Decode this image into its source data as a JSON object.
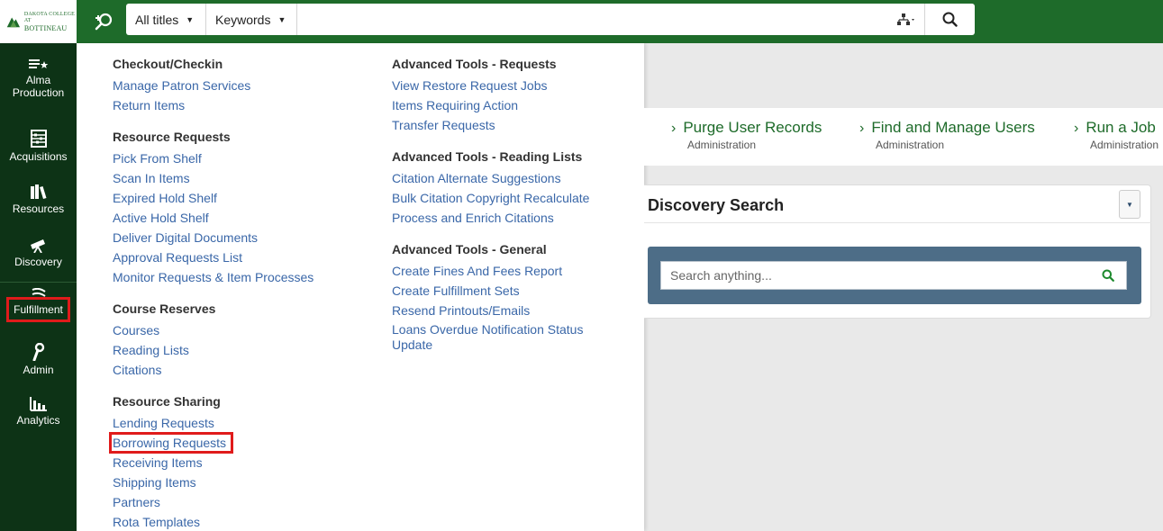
{
  "logo": {
    "text_line1": "DAKOTA COLLEGE AT",
    "text_line2": "BOTTINEAU"
  },
  "search": {
    "scope_label": "All titles",
    "field_label": "Keywords",
    "query": "",
    "caret": "▼"
  },
  "nav": {
    "items": [
      {
        "label": "Alma Production",
        "icon": "star-list-icon"
      },
      {
        "label": "Acquisitions",
        "icon": "abacus-icon"
      },
      {
        "label": "Resources",
        "icon": "books-icon"
      },
      {
        "label": "Discovery",
        "icon": "telescope-icon"
      },
      {
        "label": "Fulfillment",
        "icon": "fulfillment-icon"
      },
      {
        "label": "Admin",
        "icon": "wrench-icon"
      },
      {
        "label": "Analytics",
        "icon": "bar-chart-icon"
      }
    ]
  },
  "menu": {
    "col1": [
      {
        "title": "Checkout/Checkin",
        "items": [
          "Manage Patron Services",
          "Return Items"
        ]
      },
      {
        "title": "Resource Requests",
        "items": [
          "Pick From Shelf",
          "Scan In Items",
          "Expired Hold Shelf",
          "Active Hold Shelf",
          "Deliver Digital Documents",
          "Approval Requests List",
          "Monitor Requests & Item Processes"
        ]
      },
      {
        "title": "Course Reserves",
        "items": [
          "Courses",
          "Reading Lists",
          "Citations"
        ]
      },
      {
        "title": "Resource Sharing",
        "items": [
          "Lending Requests",
          "Borrowing Requests",
          "Receiving Items",
          "Shipping Items",
          "Partners",
          "Rota Templates"
        ]
      }
    ],
    "col2": [
      {
        "title": "Advanced Tools - Requests",
        "items": [
          "View Restore Request Jobs",
          "Items Requiring Action",
          "Transfer Requests"
        ]
      },
      {
        "title": "Advanced Tools - Reading Lists",
        "items": [
          "Citation Alternate Suggestions",
          "Bulk Citation Copyright Recalculate",
          "Process and Enrich Citations"
        ]
      },
      {
        "title": "Advanced Tools - General",
        "items": [
          "Create Fines And Fees Report",
          "Create Fulfillment Sets",
          "Resend Printouts/Emails",
          "Loans Overdue Notification Status\nUpdate"
        ]
      }
    ]
  },
  "quicklinks": [
    {
      "title": "Purge User Records",
      "subtitle": "Administration"
    },
    {
      "title": "Find and Manage Users",
      "subtitle": "Administration"
    },
    {
      "title": "Run a Job",
      "subtitle": "Administration"
    }
  ],
  "discovery_widget": {
    "title": "Discovery Search",
    "placeholder": "Search anything..."
  },
  "colors": {
    "brand_green": "#1e6b2a",
    "nav_bg": "#0d3316",
    "link_blue": "#3a67a8",
    "highlight_red": "#e01b1b",
    "panel_slate": "#4d6d87"
  }
}
